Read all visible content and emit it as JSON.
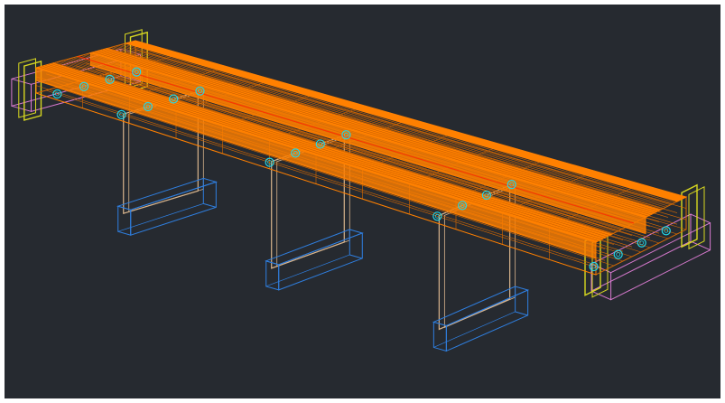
{
  "viewport": {
    "background": "#262a30",
    "view": "3d-wireframe"
  },
  "model": {
    "pier_count": 3,
    "colors": {
      "deck": "#ff8000",
      "deck_line": "#d96a00",
      "centerline": "#ff3000",
      "pier": "#d8b48c",
      "footing": "#2f7fe0",
      "bearing": "#22d6e6",
      "abutment_backwall": "#d8d820",
      "abutment_cap": "#d97ad0"
    }
  }
}
